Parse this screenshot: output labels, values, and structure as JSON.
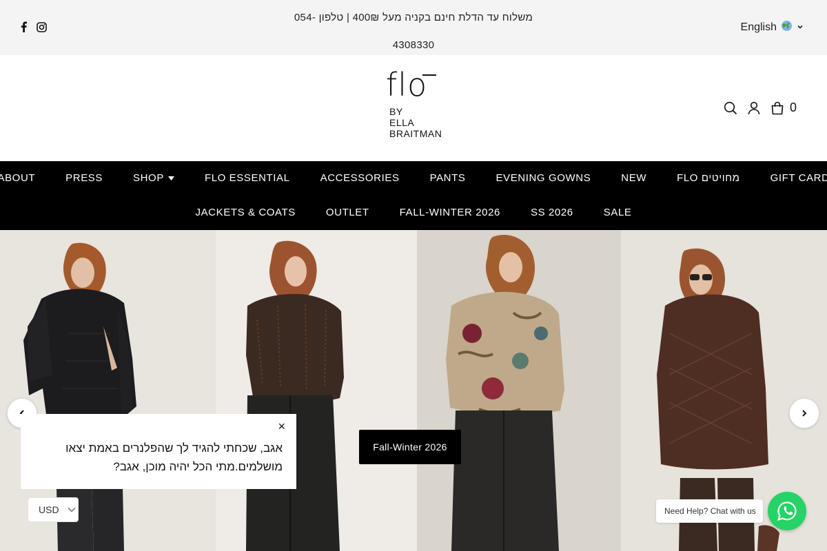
{
  "announcement": {
    "text": "משלוח עד הדלת חינם בקניה מעל 400₪ | טלפון -054 4308330"
  },
  "social": {
    "icons": [
      "facebook-icon",
      "instagram-icon"
    ]
  },
  "language": {
    "label": "English",
    "icon": "globe-icon"
  },
  "logo": {
    "main": "flo",
    "sub_line1": "BY",
    "sub_line2": "ELLA",
    "sub_line3": "BRAITMAN"
  },
  "header": {
    "cart_count": "0",
    "icons": [
      "search-icon",
      "user-icon",
      "cart-icon"
    ]
  },
  "nav": {
    "row1": [
      "ABOUT",
      "PRESS",
      "SHOP",
      "FLO ESSENTIAL",
      "ACCESSORIES",
      "PANTS",
      "EVENING GOWNS",
      "NEW",
      "FLO מחויטים",
      "GIFT CARD"
    ],
    "row2": [
      "JACKETS & COATS",
      "OUTLET",
      "FALL-WINTER 2026",
      "SS 2026",
      "SALE"
    ]
  },
  "hero": {
    "button_label": "Fall-Winter 2026"
  },
  "popup": {
    "text": "אגב, שכחתי להגיד לך שהפלנרים באמת יצאו מושלמים.מתי הכל יהיה מוכן, אגב?",
    "close": "×"
  },
  "currency": {
    "value": "USD"
  },
  "whatsapp": {
    "label": "Need Help? Chat with us"
  },
  "colors": {
    "announce_bg": "#f4f4f4",
    "nav_bg": "#000000",
    "whatsapp": "#25d366"
  }
}
